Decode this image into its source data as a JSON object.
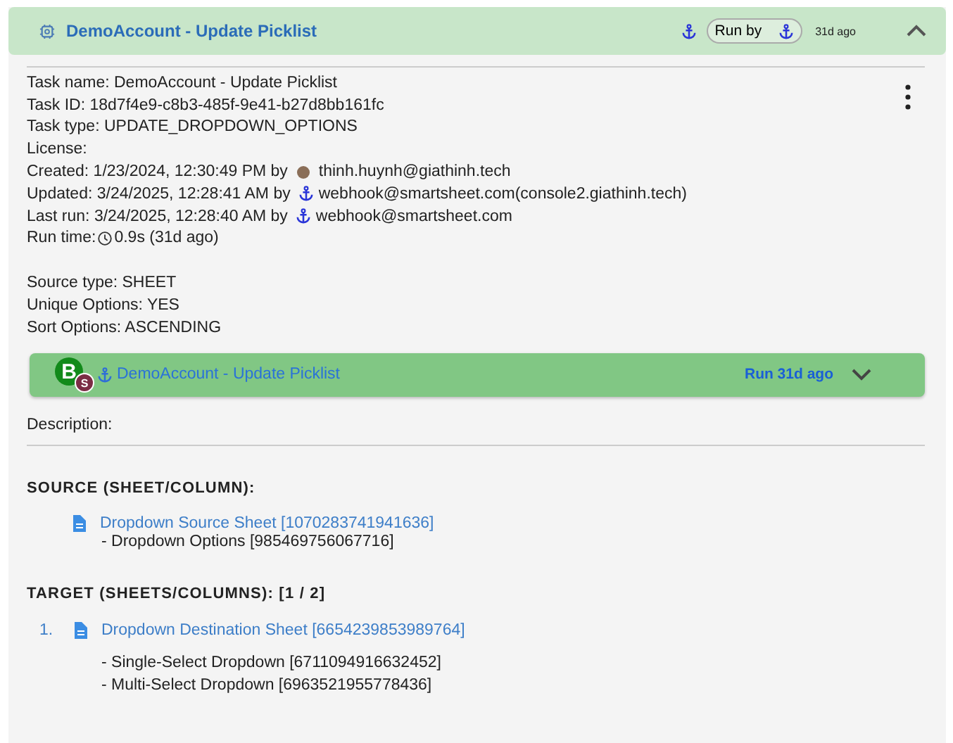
{
  "header": {
    "title": "DemoAccount - Update Picklist",
    "run_by_label": "Run by",
    "age": "31d ago",
    "expanded": true
  },
  "info": [
    {
      "kind": "plain",
      "text": "Task name: DemoAccount - Update Picklist"
    },
    {
      "kind": "plain",
      "text": "Task ID: 18d7f4e9-c8b3-485f-9e41-b27d8bb161fc"
    },
    {
      "kind": "plain",
      "text": "Task type: UPDATE_DROPDOWN_OPTIONS"
    },
    {
      "kind": "plain",
      "text": "License:"
    },
    {
      "kind": "by_avatar",
      "text": "Created: 1/23/2024, 12:30:49 PM by",
      "user": "thinh.huynh@giathinh.tech"
    },
    {
      "kind": "by_anchor",
      "text": "Updated: 3/24/2025, 12:28:41 AM by",
      "user": "webhook@smartsheet.com(console2.giathinh.tech)"
    },
    {
      "kind": "by_anchor",
      "text": "Last run: 3/24/2025, 12:28:40 AM by",
      "user": "webhook@smartsheet.com"
    },
    {
      "kind": "runtime",
      "text": "Run time:",
      "value": "0.9s (31d ago)"
    }
  ],
  "options": [
    "Source type: SHEET",
    "Unique Options: YES",
    "Sort Options: ASCENDING"
  ],
  "run_bar": {
    "avatar": "B",
    "badge": "S",
    "title": "DemoAccount - Update Picklist",
    "run": "Run 31d ago",
    "expanded": false
  },
  "description_label": "Description:",
  "source": {
    "heading": "SOURCE (SHEET/COLUMN):",
    "sheet": "Dropdown Source Sheet [1070283741941636]",
    "columns": [
      "- Dropdown Options [985469756067716]"
    ]
  },
  "target": {
    "heading": "TARGET (SHEETS/COLUMNS): [1 / 2]",
    "items": [
      {
        "number": "1.",
        "sheet": "Dropdown Destination Sheet [6654239853989764]",
        "columns": [
          "- Single-Select Dropdown [6711094916632452]",
          "- Multi-Select Dropdown [6963521955778436]"
        ]
      }
    ]
  }
}
